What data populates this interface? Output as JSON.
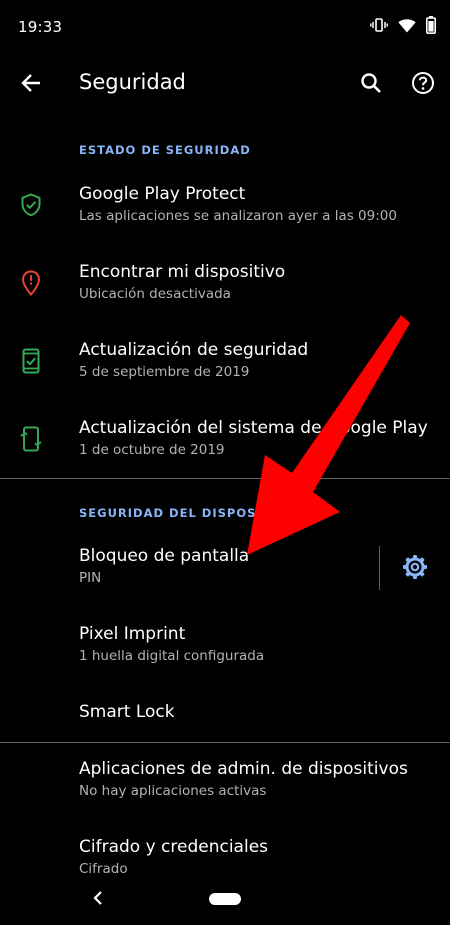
{
  "status_bar": {
    "time": "19:33",
    "icons": [
      "vibrate-icon",
      "wifi-icon",
      "battery-icon"
    ]
  },
  "app_bar": {
    "title": "Seguridad",
    "back_icon": "arrow-back-icon",
    "search_icon": "search-icon",
    "help_icon": "help-icon"
  },
  "sections": {
    "status_header": "ESTADO DE SEGURIDAD",
    "device_header": "SEGURIDAD DEL DISPOSITIVO"
  },
  "status_items": [
    {
      "title": "Google Play Protect",
      "subtitle": "Las aplicaciones se analizaron ayer a las 09:00",
      "icon": "shield-check-icon"
    },
    {
      "title": "Encontrar mi dispositivo",
      "subtitle": "Ubicación desactivada",
      "icon": "location-alert-icon"
    },
    {
      "title": "Actualización de seguridad",
      "subtitle": "5 de septiembre de 2019",
      "icon": "phone-check-icon"
    },
    {
      "title": "Actualización del sistema de Google Play",
      "subtitle": "1 de octubre de 2019",
      "icon": "phone-update-icon"
    }
  ],
  "device_items": [
    {
      "title": "Bloqueo de pantalla",
      "subtitle": "PIN",
      "icon": "gear-icon"
    },
    {
      "title": "Pixel Imprint",
      "subtitle": "1 huella digital configurada"
    },
    {
      "title": "Smart Lock"
    }
  ],
  "other_items": [
    {
      "title": "Aplicaciones de admin. de dispositivos",
      "subtitle": "No hay aplicaciones activas"
    },
    {
      "title": "Cifrado y credenciales",
      "subtitle": "Cifrado"
    }
  ],
  "nav_bar": {
    "back_icon": "nav-back-icon",
    "home_icon": "home-pill-icon"
  },
  "colors": {
    "background": "#000000",
    "accent": "#8ab4f8",
    "status_green": "#34a853",
    "status_red": "#ea4335",
    "annotation_arrow": "#ff0000",
    "secondary_text": "#b3b3b3"
  }
}
